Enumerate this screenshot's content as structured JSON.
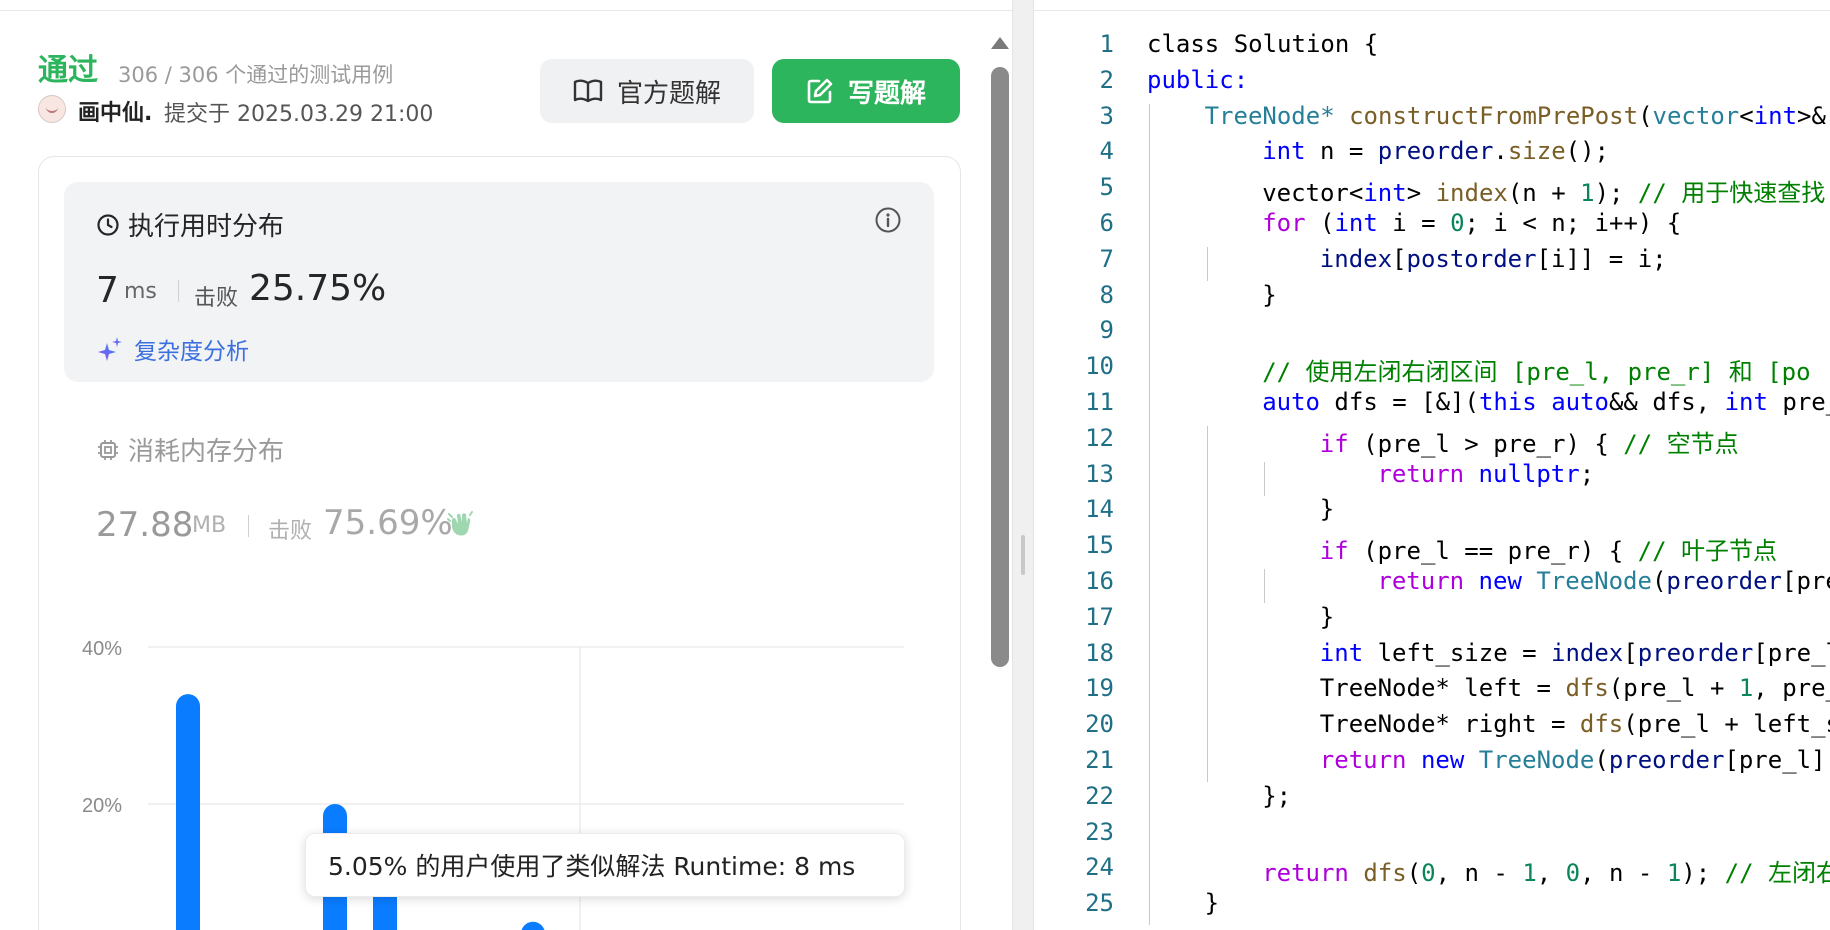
{
  "left": {
    "status": "通过",
    "count": "306 / 306 个通过的测试用例",
    "user": "画中仙.",
    "submitted": "提交于 2025.03.29 21:00",
    "buttons": {
      "official": "官方题解",
      "write": "写题解"
    },
    "runtime": {
      "title": "执行用时分布",
      "value": "7",
      "unit": "ms",
      "beat_label": "击败",
      "beat": "25.75%",
      "complexity": "复杂度分析"
    },
    "memory": {
      "title": "消耗内存分布",
      "value": "27.88",
      "unit": "MB",
      "beat_label": "击败",
      "beat": "75.69%"
    },
    "tooltip": "5.05% 的用户使用了类似解法 Runtime: 8 ms",
    "colors": {
      "accent": "#2db55d",
      "bar": "#0a7cff",
      "link": "#3b6fe0"
    }
  },
  "chart_data": {
    "type": "bar",
    "y_ticks": [
      "40%",
      "20%"
    ],
    "ylim": [
      0,
      40
    ],
    "bars": [
      {
        "y": 34
      },
      {
        "y": 20
      },
      {
        "y": 12
      },
      {
        "y": 5
      },
      {
        "y": 3.5
      }
    ]
  },
  "code": {
    "lines": [
      [
        [
          "class Solution {",
          ""
        ]
      ],
      [
        [
          "public:",
          "kw"
        ]
      ],
      [
        [
          "TreeNode*",
          "ty"
        ],
        [
          " ",
          ""
        ],
        [
          "constructFromPrePost",
          "fn"
        ],
        [
          "(",
          ""
        ],
        [
          "vector",
          "ty"
        ],
        [
          "<",
          ""
        ],
        [
          "int",
          "kw"
        ],
        [
          ">&",
          ""
        ]
      ],
      [
        [
          "int",
          "kw"
        ],
        [
          " n = ",
          ""
        ],
        [
          "preorder",
          "var"
        ],
        [
          ".",
          ""
        ],
        [
          "size",
          "fn"
        ],
        [
          "();",
          ""
        ]
      ],
      [
        [
          "vector<",
          ""
        ],
        [
          "int",
          "kw"
        ],
        [
          "> ",
          ""
        ],
        [
          "index",
          "fn"
        ],
        [
          "(n + ",
          ""
        ],
        [
          "1",
          "num"
        ],
        [
          "); ",
          ""
        ],
        [
          "// 用于快速查找",
          "cm"
        ]
      ],
      [
        [
          "for",
          "ctl"
        ],
        [
          " (",
          ""
        ],
        [
          "int",
          "kw"
        ],
        [
          " i = ",
          ""
        ],
        [
          "0",
          "num"
        ],
        [
          "; i < n; i++) {",
          ""
        ]
      ],
      [
        [
          "index",
          "var"
        ],
        [
          "[",
          ""
        ],
        [
          "postorder",
          "var"
        ],
        [
          "[i]] = i;",
          ""
        ]
      ],
      [
        [
          "}",
          ""
        ]
      ],
      [],
      [
        [
          "// 使用左闭右闭区间 [pre_l, pre_r] 和 [po",
          "cm"
        ]
      ],
      [
        [
          "auto",
          "kw"
        ],
        [
          " dfs = [&](",
          ""
        ],
        [
          "this",
          "kw"
        ],
        [
          " ",
          ""
        ],
        [
          "auto",
          "kw"
        ],
        [
          "&& dfs, ",
          ""
        ],
        [
          "int",
          "kw"
        ],
        [
          " pre_",
          ""
        ]
      ],
      [
        [
          "if",
          "ctl"
        ],
        [
          " (pre_l > pre_r) { ",
          ""
        ],
        [
          "// 空节点",
          "cm"
        ]
      ],
      [
        [
          "return",
          "ctl"
        ],
        [
          " ",
          ""
        ],
        [
          "nullptr",
          "kw"
        ],
        [
          ";",
          ""
        ]
      ],
      [
        [
          "}",
          ""
        ]
      ],
      [
        [
          "if",
          "ctl"
        ],
        [
          " (pre_l == pre_r) { ",
          ""
        ],
        [
          "// 叶子节点",
          "cm"
        ]
      ],
      [
        [
          "return",
          "ctl"
        ],
        [
          " ",
          ""
        ],
        [
          "new",
          "kw"
        ],
        [
          " ",
          ""
        ],
        [
          "TreeNode",
          "ty"
        ],
        [
          "(",
          ""
        ],
        [
          "preorder",
          "var"
        ],
        [
          "[pre",
          ""
        ]
      ],
      [
        [
          "}",
          ""
        ]
      ],
      [
        [
          "int",
          "kw"
        ],
        [
          " left_size = ",
          ""
        ],
        [
          "index",
          "var"
        ],
        [
          "[",
          ""
        ],
        [
          "preorder",
          "var"
        ],
        [
          "[pre_l",
          ""
        ]
      ],
      [
        [
          "TreeNode* left = ",
          ""
        ],
        [
          "dfs",
          "fn"
        ],
        [
          "(pre_l + ",
          ""
        ],
        [
          "1",
          "num"
        ],
        [
          ", pre_",
          ""
        ]
      ],
      [
        [
          "TreeNode* right = ",
          ""
        ],
        [
          "dfs",
          "fn"
        ],
        [
          "(pre_l + left_s",
          ""
        ]
      ],
      [
        [
          "return",
          "ctl"
        ],
        [
          " ",
          ""
        ],
        [
          "new",
          "kw"
        ],
        [
          " ",
          ""
        ],
        [
          "TreeNode",
          "ty"
        ],
        [
          "(",
          ""
        ],
        [
          "preorder",
          "var"
        ],
        [
          "[pre_l],",
          ""
        ]
      ],
      [
        [
          "};",
          ""
        ]
      ],
      [],
      [
        [
          "return",
          "ctl"
        ],
        [
          " ",
          ""
        ],
        [
          "dfs",
          "fn"
        ],
        [
          "(",
          ""
        ],
        [
          "0",
          "num"
        ],
        [
          ", n - ",
          ""
        ],
        [
          "1",
          "num"
        ],
        [
          ", ",
          ""
        ],
        [
          "0",
          "num"
        ],
        [
          ", n - ",
          ""
        ],
        [
          "1",
          "num"
        ],
        [
          "); ",
          ""
        ],
        [
          "// 左闭右",
          "cm"
        ]
      ],
      [
        [
          "}",
          ""
        ]
      ]
    ]
  }
}
